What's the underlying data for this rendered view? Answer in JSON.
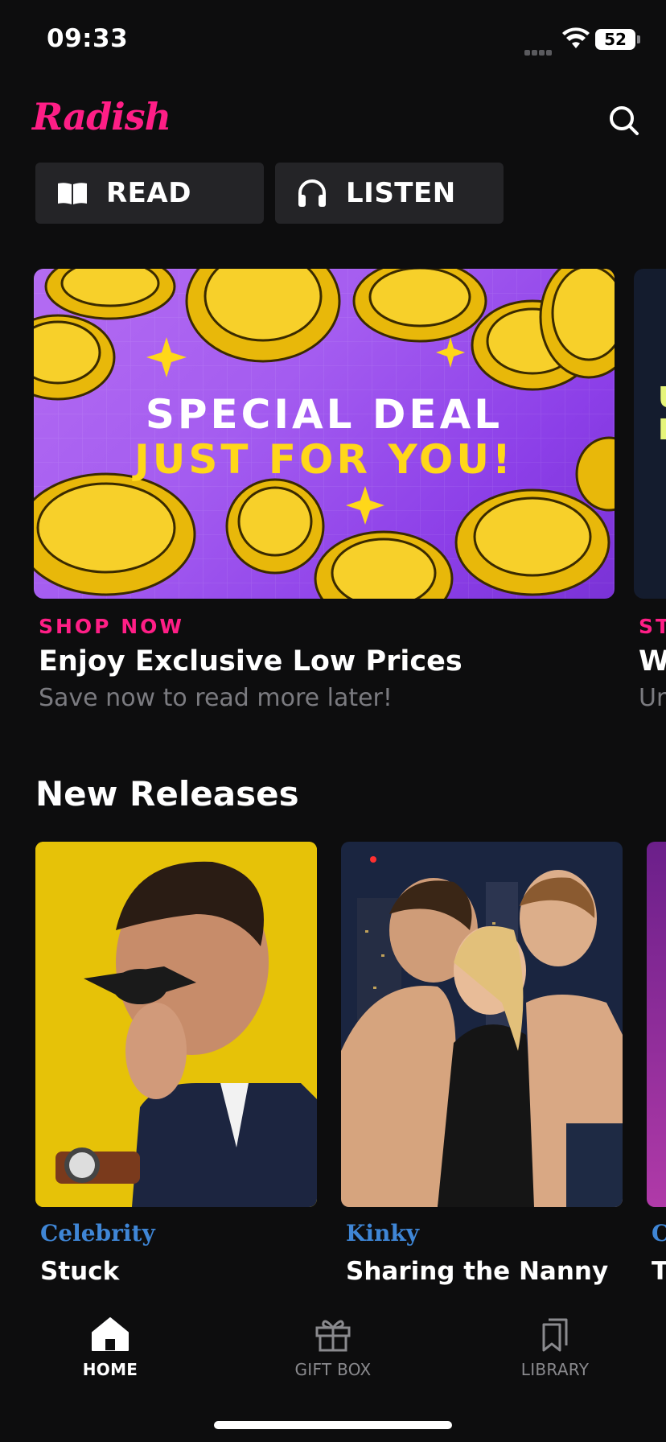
{
  "status_bar": {
    "time": "09:33",
    "battery": "52"
  },
  "header": {
    "logo": "Radish",
    "search_icon": "search-icon"
  },
  "mode_toggle": {
    "read_label": "READ",
    "listen_label": "LISTEN",
    "read_icon": "book-open-icon",
    "listen_icon": "headphones-icon"
  },
  "banner": {
    "line1": "SPECIAL DEAL",
    "line2": "JUST FOR YOU!",
    "kicker": "SHOP NOW",
    "title": "Enjoy Exclusive Low Prices",
    "subtitle": "Save now to read more later!",
    "colors": {
      "accent": "#ff1e86",
      "yellow": "#ffd719",
      "purple": "#a45cf0"
    }
  },
  "banner_peek": {
    "kicker": "ST",
    "title": "W",
    "subtitle": "Ur"
  },
  "new_releases": {
    "title": "New Releases",
    "books": [
      {
        "genre": "Celebrity",
        "title": "Stuck"
      },
      {
        "genre": "Kinky",
        "title": "Sharing the Nanny"
      },
      {
        "genre": "C",
        "title": "T"
      }
    ]
  },
  "tab_bar": {
    "home": "HOME",
    "gift_box": "GIFT BOX",
    "library": "LIBRARY"
  }
}
